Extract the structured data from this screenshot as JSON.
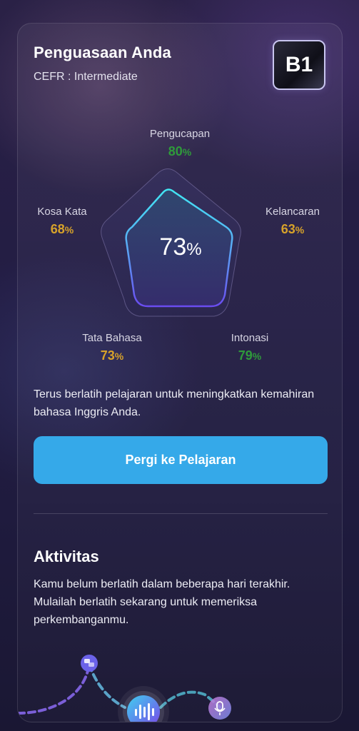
{
  "header": {
    "title": "Penguasaan Anda",
    "subtitle": "CEFR : Intermediate",
    "level": "B1"
  },
  "radar": {
    "overall": "73",
    "overall_unit": "%",
    "skills": [
      {
        "label": "Pengucapan",
        "value": "80",
        "unit": "%",
        "color": "#2f9a3b"
      },
      {
        "label": "Kelancaran",
        "value": "63",
        "unit": "%",
        "color": "#d7a22a"
      },
      {
        "label": "Intonasi",
        "value": "79",
        "unit": "%",
        "color": "#2f9a3b"
      },
      {
        "label": "Tata Bahasa",
        "value": "73",
        "unit": "%",
        "color": "#d7a22a"
      },
      {
        "label": "Kosa Kata",
        "value": "68",
        "unit": "%",
        "color": "#d7a22a"
      }
    ]
  },
  "description": "Terus berlatih pelajaran untuk meningkatkan kemahiran bahasa Inggris Anda.",
  "cta": {
    "label": "Pergi ke Pelajaran",
    "color": "#35a9e9"
  },
  "activity": {
    "title": "Aktivitas",
    "text": "Kamu belum berlatih dalam beberapa hari terakhir. Mulailah berlatih sekarang untuk memeriksa perkembanganmu.",
    "icons": [
      "chat-icon",
      "waveform-icon",
      "microphone-icon"
    ]
  }
}
